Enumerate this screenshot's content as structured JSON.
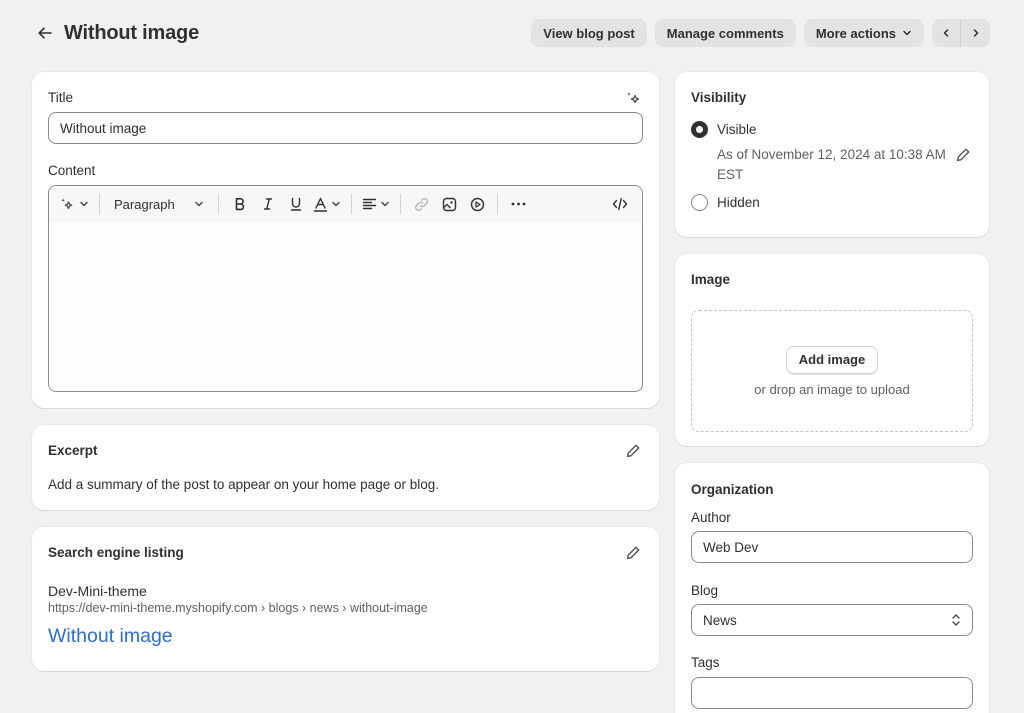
{
  "header": {
    "title": "Without image",
    "view_blog_post": "View blog post",
    "manage_comments": "Manage comments",
    "more_actions": "More actions"
  },
  "title_card": {
    "title_label": "Title",
    "title_value": "Without image",
    "content_label": "Content",
    "paragraph_label": "Paragraph"
  },
  "excerpt": {
    "title": "Excerpt",
    "description": "Add a summary of the post to appear on your home page or blog."
  },
  "seo": {
    "title": "Search engine listing",
    "site_name": "Dev-Mini-theme",
    "url": "https://dev-mini-theme.myshopify.com › blogs › news › without-image",
    "page_title": "Without image"
  },
  "visibility": {
    "title": "Visibility",
    "visible_label": "Visible",
    "visible_date": "As of November 12, 2024 at 10:38 AM EST",
    "hidden_label": "Hidden"
  },
  "image": {
    "title": "Image",
    "add_button": "Add image",
    "hint": "or drop an image to upload"
  },
  "organization": {
    "title": "Organization",
    "author_label": "Author",
    "author_value": "Web Dev",
    "blog_label": "Blog",
    "blog_value": "News",
    "tags_label": "Tags",
    "tags_value": ""
  },
  "colors": {
    "background": "#f1f1f1",
    "link": "#2c6ecb",
    "text": "#303030"
  }
}
